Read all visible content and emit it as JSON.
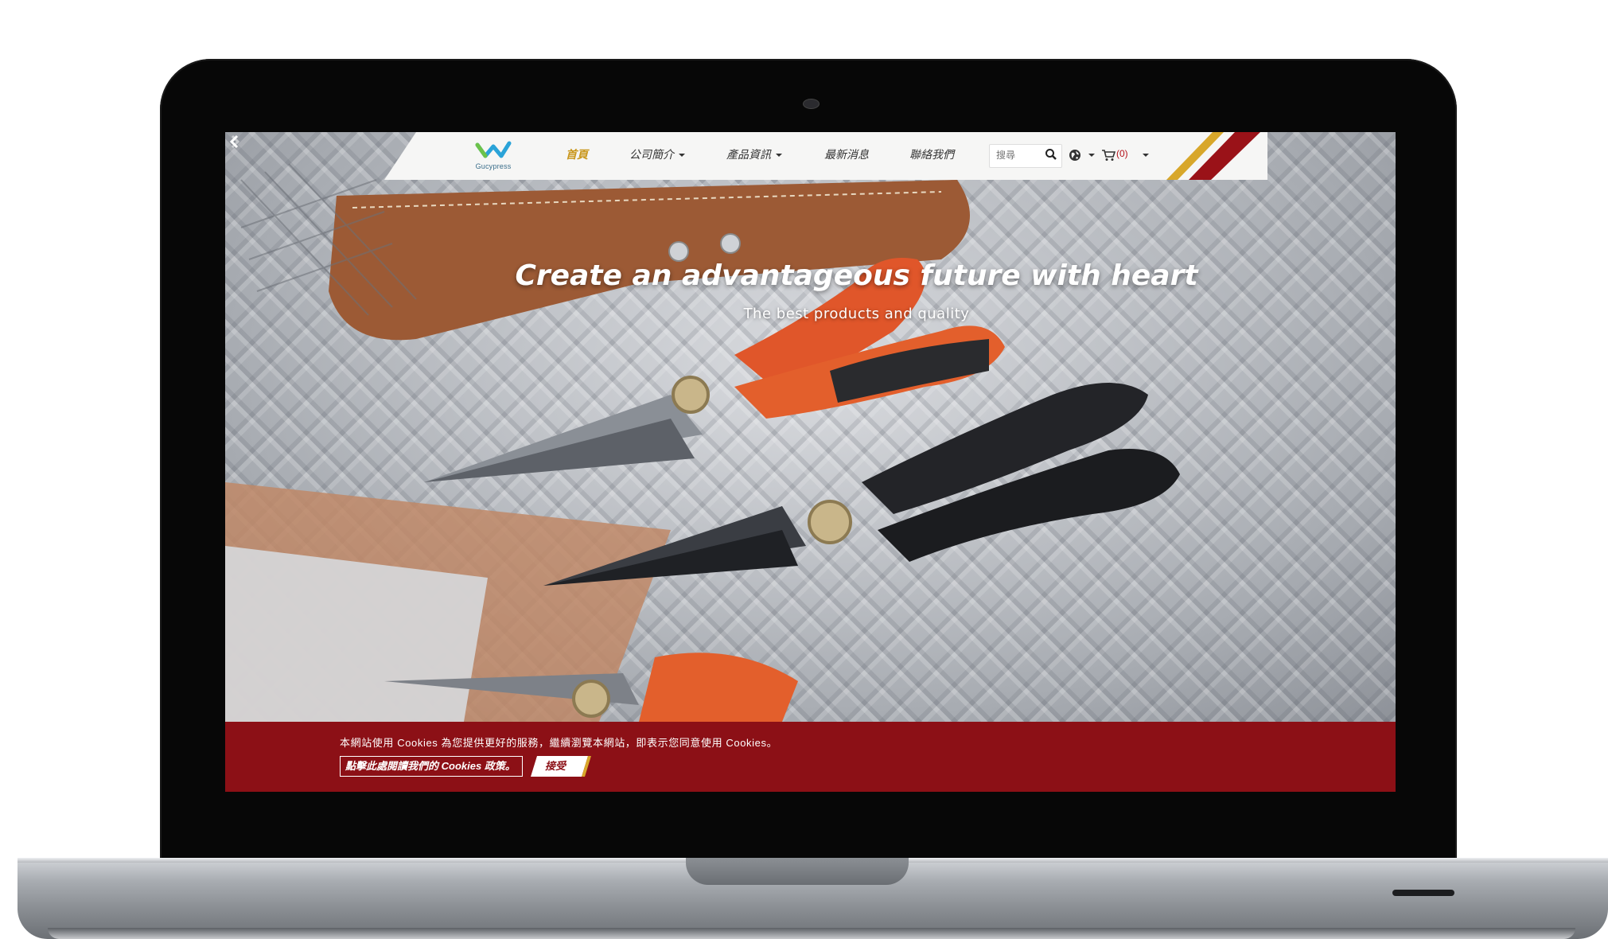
{
  "site": {
    "logo_text": "Gucypress"
  },
  "nav": {
    "items": [
      {
        "label": "首頁",
        "active": true
      },
      {
        "label": "公司簡介",
        "dropdown": true
      },
      {
        "label": "產品資訊",
        "dropdown": true
      },
      {
        "label": "最新消息"
      },
      {
        "label": "聯絡我們"
      }
    ],
    "search_placeholder": "搜尋",
    "cart_count": "(0)"
  },
  "hero": {
    "title": "Create an advantageous future with heart",
    "subtitle": "The best products and quality"
  },
  "cookie": {
    "message": "本網站使用 Cookies 為您提供更好的服務，繼續瀏覽本網站，即表示您同意使用 Cookies。",
    "policy_link": "點擊此處閱讀我們的 Cookies 政策。",
    "accept_label": "接受"
  },
  "colors": {
    "accent_red": "#8c1016",
    "accent_gold": "#d8a72a",
    "nav_active": "#c9961a"
  },
  "icons": {
    "search": "search-icon",
    "language": "globe-icon",
    "cart": "cart-icon",
    "carousel_prev": "chevron-left-icon",
    "carousel_next": "chevron-right-icon"
  }
}
